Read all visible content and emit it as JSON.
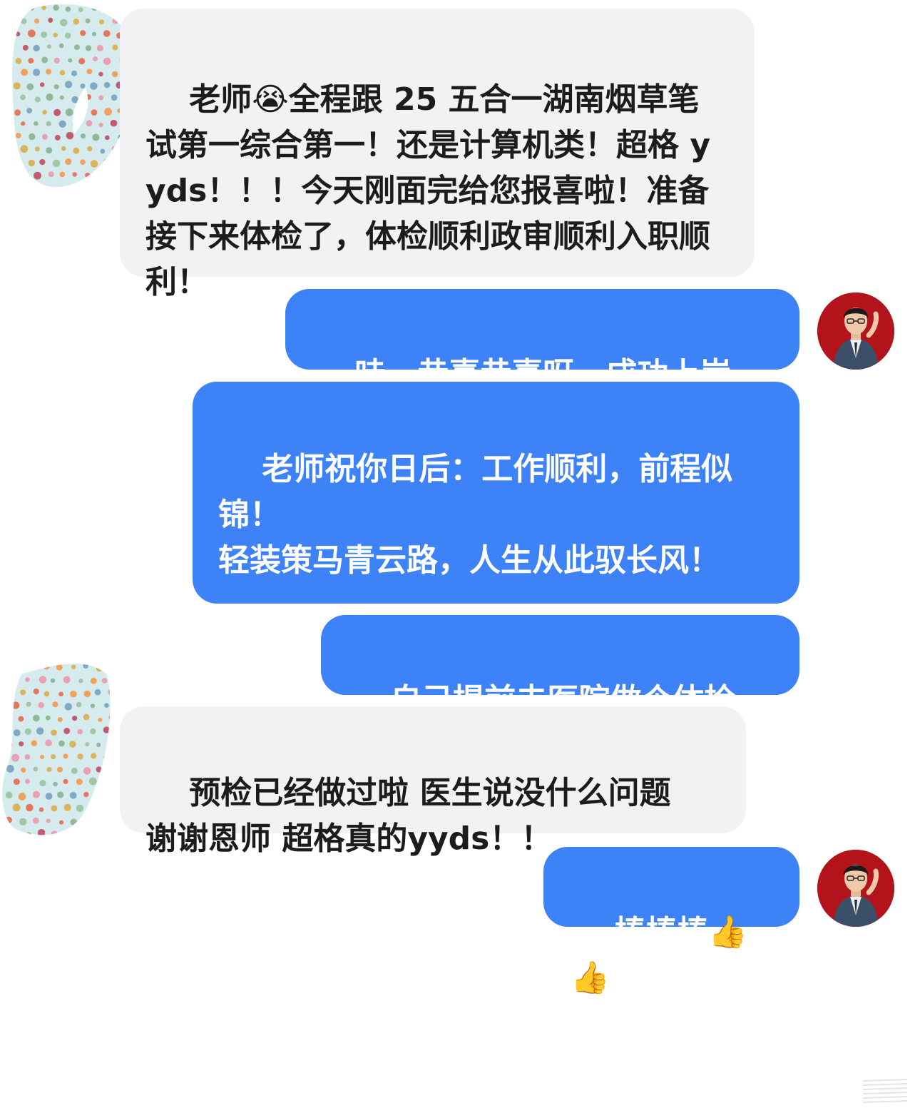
{
  "conversation": {
    "messages": [
      {
        "sender": "student",
        "text": "老师😭全程跟 25 五合一湖南烟草笔试第一综合第一！还是计算机类！超格 yyds！！！今天刚面完给您报喜啦！准备接下来体检了，体检顺利政审顺利入职顺利！"
      },
      {
        "sender": "teacher",
        "text": "哇，恭喜恭喜呀，成功上岸。"
      },
      {
        "sender": "teacher",
        "text": "老师祝你日后：工作顺利，前程似锦！\n轻装策马青云路，人生从此驭长风！"
      },
      {
        "sender": "teacher",
        "text": "自己提前去医院做个体检。"
      },
      {
        "sender": "student",
        "text": "预检已经做过啦 医生说没什么问题\n谢谢恩师 超格真的yyds！！"
      },
      {
        "sender": "teacher",
        "text": "棒棒棒👍👍"
      }
    ]
  },
  "icons": {
    "student_avatar": "polka-dot-redacted-avatar",
    "teacher_avatar": "teacher-portrait-avatar"
  },
  "colors": {
    "incoming_bubble": "#f2f2f4",
    "outgoing_bubble": "#3d82f6",
    "teacher_avatar_bg": "#b3131a"
  }
}
